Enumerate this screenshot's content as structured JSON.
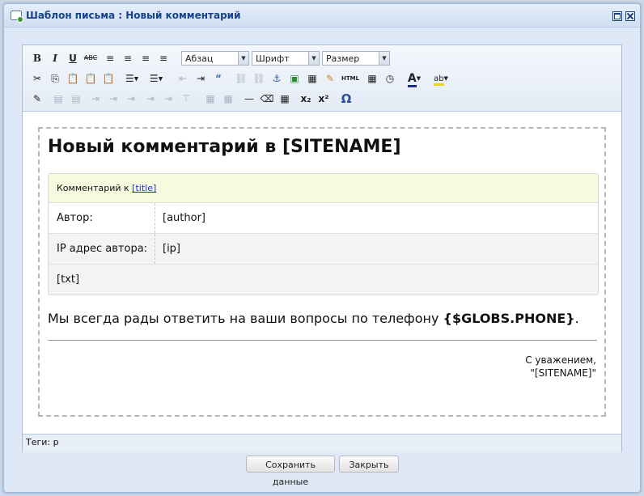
{
  "window": {
    "title": "Шаблон письма : Новый комментарий"
  },
  "toolbar": {
    "row1": [
      "B",
      "I",
      "U",
      "ABC",
      "≡",
      "≡",
      "≡",
      "≡"
    ],
    "format_select": "Абзац",
    "font_select": "Шрифт",
    "size_select": "Размер",
    "row2": [
      "✂",
      "⎘",
      "📋",
      "📋",
      "📋",
      "☰",
      "☰",
      "⇤",
      "⇥",
      "“",
      "⛓",
      "⛓",
      "⚓",
      "▣",
      "▦",
      "✎",
      "HTML",
      "▦",
      "◷",
      "A",
      "ab"
    ],
    "row3": [
      "✎",
      "▤",
      "▤",
      "⇥",
      "⇥",
      "⇥",
      "⇥",
      "⇥",
      "⊤",
      "▦",
      "▦",
      "—",
      "⌫",
      "▦",
      "x₂",
      "x²",
      "Ω"
    ]
  },
  "document": {
    "heading": "Новый комментарий в [SITENAME]",
    "comment_head_prefix": "Комментарий к",
    "comment_head_link": "[title]",
    "author_label": "Автор:",
    "author_value": "[author]",
    "ip_label": "IP адрес автора:",
    "ip_value": "[ip]",
    "txt_value": "[txt]",
    "footer_prefix": "Мы всегда рады ответить на ваши вопросы по телефону",
    "footer_phone": "{$GLOBS.PHONE}",
    "footer_suffix": ".",
    "regards_line1": "С уважением,",
    "regards_line2": "\"[SITENAME]\""
  },
  "status": {
    "tags": "Теги: p"
  },
  "buttons": {
    "save": "Сохранить данные",
    "close": "Закрыть"
  },
  "colors": {
    "title_text": "#15428b",
    "link": "#1a2fc9",
    "comment_head_bg": "#f6fbdf"
  }
}
